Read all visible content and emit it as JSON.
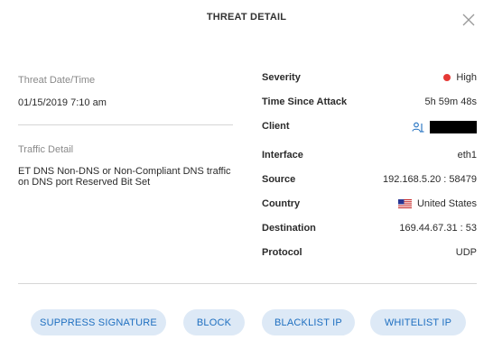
{
  "dialog": {
    "title": "THREAT DETAIL"
  },
  "left": {
    "date_label": "Threat Date/Time",
    "date_value": "01/15/2019 7:10 am",
    "traffic_label": "Traffic Detail",
    "traffic_value": "ET DNS Non-DNS or Non-Compliant DNS traffic on DNS port Reserved Bit Set"
  },
  "details": {
    "severity_label": "Severity",
    "severity_value": "High",
    "severity_color": "#e53935",
    "time_label": "Time Since Attack",
    "time_value": "5h 59m 48s",
    "client_label": "Client",
    "client_icon": "user-network-icon",
    "interface_label": "Interface",
    "interface_value": "eth1",
    "source_label": "Source",
    "source_value": "192.168.5.20 : 58479",
    "country_label": "Country",
    "country_value": "United States",
    "country_flag": "us-flag-icon",
    "destination_label": "Destination",
    "destination_value": "169.44.67.31 : 53",
    "protocol_label": "Protocol",
    "protocol_value": "UDP"
  },
  "actions": {
    "suppress": "SUPPRESS SIGNATURE",
    "block": "BLOCK",
    "blacklist": "BLACKLIST IP",
    "whitelist": "WHITELIST IP"
  },
  "colors": {
    "button_bg": "#dde9f6",
    "button_text": "#1e6fc0"
  }
}
